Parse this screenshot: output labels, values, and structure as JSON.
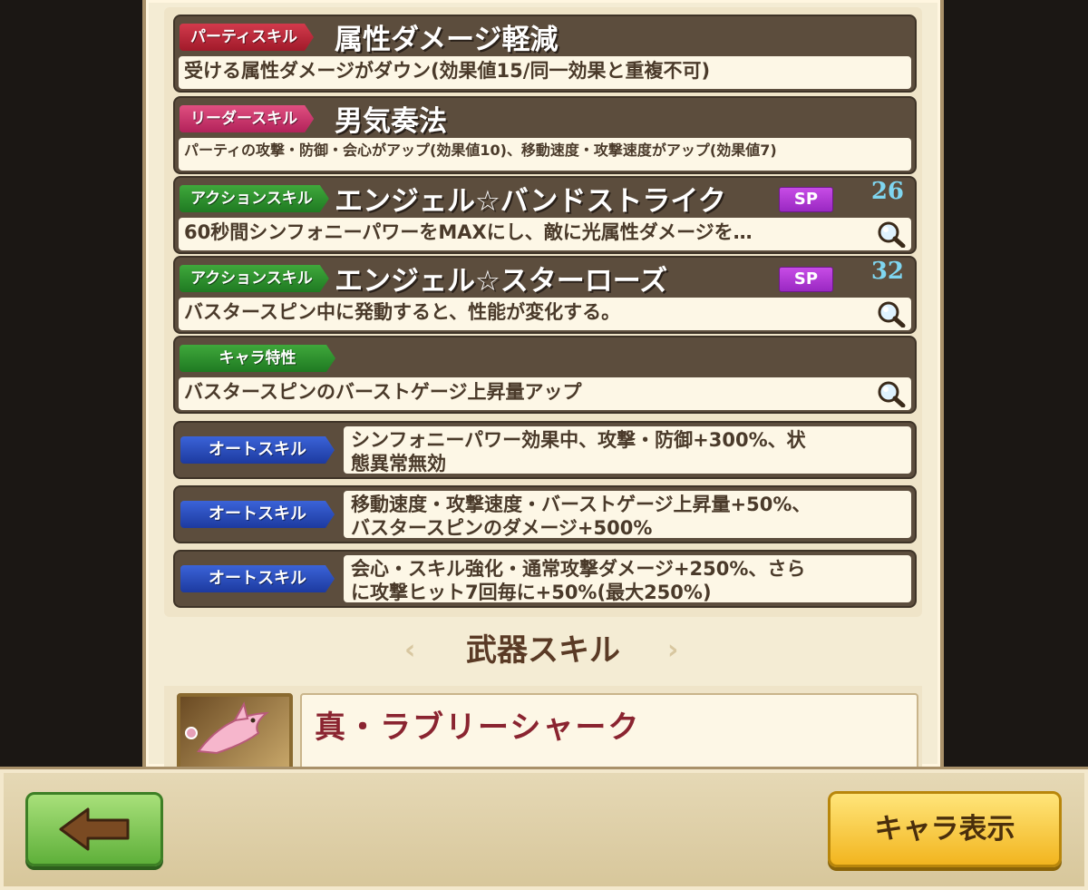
{
  "skills": [
    {
      "tag": "パーティスキル",
      "name": "属性ダメージ軽減",
      "desc": "受ける属性ダメージがダウン(効果値15/同一効果と重複不可)"
    },
    {
      "tag": "リーダースキル",
      "name": "男気奏法",
      "desc": "パーティの攻撃・防御・会心がアップ(効果値10)、移動速度・攻撃速度がアップ(効果値7)"
    },
    {
      "tag": "アクションスキル",
      "name": "エンジェル☆バンドストライク",
      "sp_label": "SP",
      "sp": "26",
      "desc": "60秒間シンフォニーパワーをMAXにし、敵に光属性ダメージを…"
    },
    {
      "tag": "アクションスキル",
      "name": "エンジェル☆スターローズ",
      "sp_label": "SP",
      "sp": "32",
      "desc": "バスタースピン中に発動すると、性能が変化する。"
    },
    {
      "tag": "キャラ特性",
      "desc": "バスタースピンのバーストゲージ上昇量アップ"
    }
  ],
  "auto_skills": [
    {
      "tag": "オートスキル",
      "line1": "シンフォニーパワー効果中、攻撃・防御+300%、状",
      "line2": "態異常無効"
    },
    {
      "tag": "オートスキル",
      "line1": "移動速度・攻撃速度・バーストゲージ上昇量+50%、",
      "line2": "バスタースピンのダメージ+500%"
    },
    {
      "tag": "オートスキル",
      "line1": "会心・スキル強化・通常攻撃ダメージ+250%、さら",
      "line2": "に攻撃ヒット7回毎に+50%(最大250%)"
    }
  ],
  "weapon_section": {
    "title": "武器スキル",
    "prev": "‹",
    "next": "›",
    "weapon_name": "真・ラブリーシャーク"
  },
  "footer": {
    "chara_button": "キャラ表示"
  },
  "icons": {
    "back": "left-arrow-icon",
    "magnifier": "magnifier-icon",
    "weapon": "shark-weapon-icon"
  },
  "colors": {
    "party_tag": "#c62b3c",
    "leader_tag": "#c83368",
    "action_tag": "#2e8f2c",
    "auto_tag": "#2a4fbf",
    "sp_badge": "#b53ad6",
    "sp_cost": "#7fd6f0"
  }
}
